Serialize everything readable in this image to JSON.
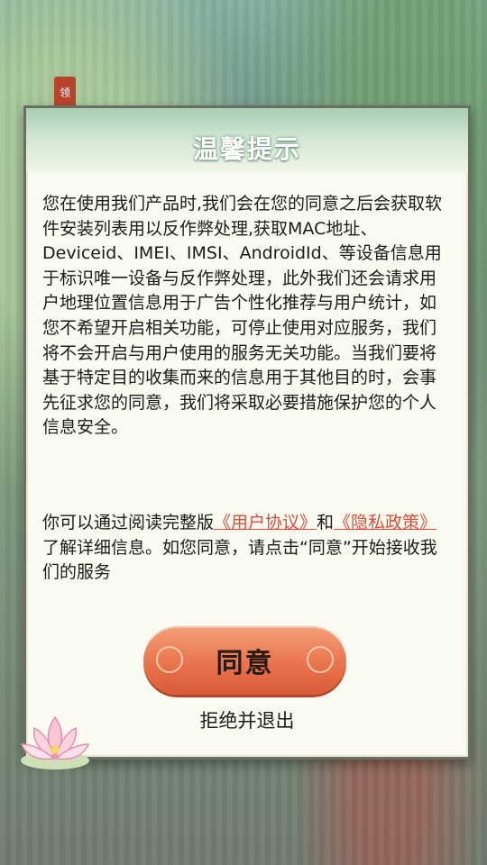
{
  "background": {
    "badge_text": "领"
  },
  "dialog": {
    "title": "温馨提示",
    "body": "您在使用我们产品时,我们会在您的同意之后会获取软件安装列表用以反作弊处理,获取MAC地址、Deviceid、IMEI、IMSI、AndroidId、等设备信息用于标识唯一设备与反作弊处理，此外我们还会请求用户地理位置信息用于广告个性化推荐与用户统计，如您不希望开启相关功能，可停止使用对应服务，我们将不会开启与用户使用的服务无关功能。当我们要将基于特定目的收集而来的信息用于其他目的时，会事先征求您的同意，我们将采取必要措施保护您的个人信息安全。",
    "policy": {
      "prefix": " 你可以通过阅读完整版",
      "user_agreement": "《用户协议》",
      "and": "和",
      "privacy_policy": "《隐私政策》",
      "suffix": "了解详细信息。如您同意，请点击“同意”开始接收我们的服务"
    },
    "agree_label": "同意",
    "reject_label": "拒绝并退出"
  },
  "colors": {
    "accent": "#e9744d",
    "link": "#d94f3a",
    "title": "#ffffff"
  }
}
